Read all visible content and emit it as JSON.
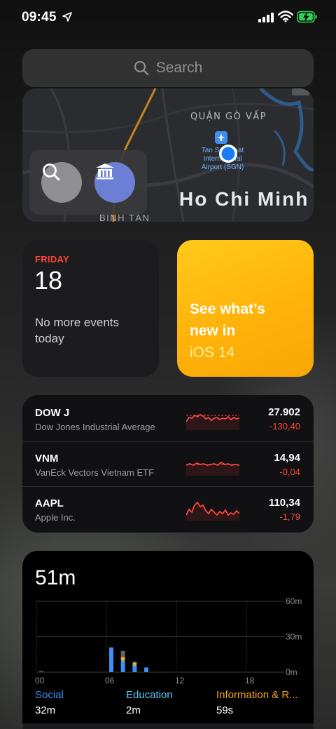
{
  "status_bar": {
    "time": "09:45"
  },
  "search": {
    "label": "Search"
  },
  "map": {
    "district": "QUẬN GÒ VẤP",
    "airport": "Tan Son Nhat International Airport (SGN)",
    "city": "Ho Chi Minh",
    "area": "BÌNH TÂN"
  },
  "calendar": {
    "day": "FRIDAY",
    "date": "18",
    "events_text": "No more events today"
  },
  "tips": {
    "line1": "See what’s",
    "line2": "new in",
    "accent": "iOS 14"
  },
  "stocks": [
    {
      "symbol": "DOW J",
      "name": "Dow Jones Industrial Average",
      "price": "27.902",
      "change": "-130,40"
    },
    {
      "symbol": "VNM",
      "name": "VanEck Vectors Vietnam ETF",
      "price": "14,94",
      "change": "-0,04"
    },
    {
      "symbol": "AAPL",
      "name": "Apple Inc.",
      "price": "110,34",
      "change": "-1,79"
    }
  ],
  "screen_time": {
    "total": "51m",
    "y_ticks": [
      "60m",
      "30m",
      "0m"
    ],
    "x_ticks": [
      "00",
      "06",
      "12",
      "18"
    ],
    "categories": [
      {
        "name": "Social",
        "time": "32m",
        "color": "#3b8ff5"
      },
      {
        "name": "Education",
        "time": "2m",
        "color": "#5ac8fa"
      },
      {
        "name": "Information & R...",
        "time": "59s",
        "color": "#f5a623"
      }
    ],
    "bars": [
      {
        "hour": 6,
        "social": 21,
        "education": 0,
        "info": 0,
        "other": 0
      },
      {
        "hour": 7,
        "social": 9,
        "education": 1,
        "info": 3,
        "other": 5
      },
      {
        "hour": 8,
        "social": 5,
        "education": 1,
        "info": 2,
        "other": 1
      },
      {
        "hour": 9,
        "social": 4,
        "education": 0,
        "info": 0,
        "other": 0
      }
    ]
  }
}
